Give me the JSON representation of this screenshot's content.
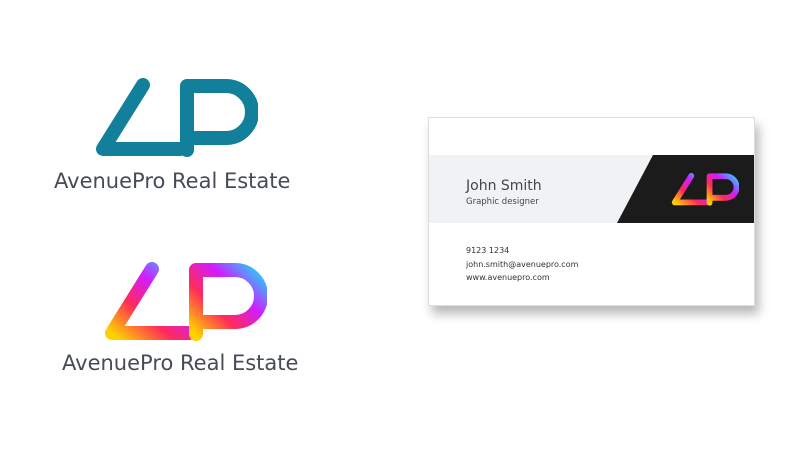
{
  "logos": [
    {
      "monogram": "AP",
      "name": "AvenuePro Real Estate",
      "style": "solid",
      "color": "#12809a"
    },
    {
      "monogram": "AP",
      "name": "AvenuePro Real Estate",
      "style": "gradient",
      "gradient": [
        "#ffd000",
        "#ff2a5a",
        "#d21cff",
        "#1ed6ff"
      ]
    }
  ],
  "card": {
    "name": "John Smith",
    "title": "Graphic designer",
    "phone": "9123 1234",
    "email": "john.smith@avenuepro.com",
    "website": "www.avenuepro.com",
    "band_color": "#f1f2f4",
    "dark_color": "#1b1b1b"
  }
}
